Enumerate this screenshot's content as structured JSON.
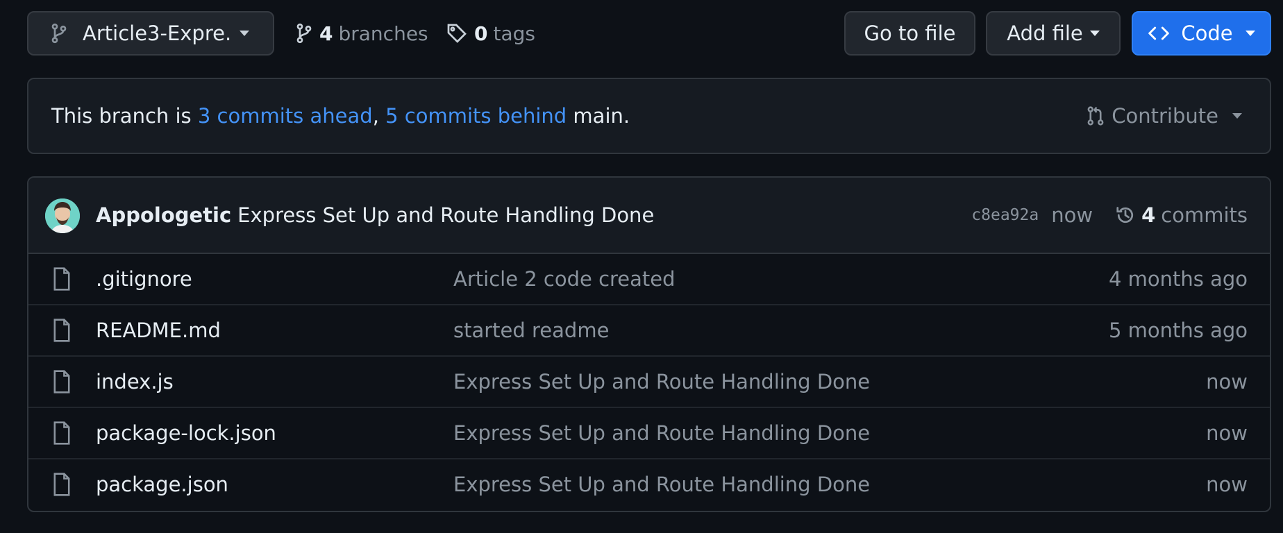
{
  "toolbar": {
    "branch_label": "Article3-Expre...",
    "branches_count": "4",
    "branches_label": "branches",
    "tags_count": "0",
    "tags_label": "tags",
    "go_to_file": "Go to file",
    "add_file": "Add file",
    "code": "Code"
  },
  "status": {
    "prefix": "This branch is ",
    "ahead": "3 commits ahead",
    "sep": ", ",
    "behind": "5 commits behind",
    "suffix": " main.",
    "contribute": "Contribute"
  },
  "latest_commit": {
    "author": "Appologetic",
    "message": "Express Set Up and Route Handling Done",
    "sha": "c8ea92a",
    "time": "now",
    "commits_count": "4",
    "commits_label": "commits"
  },
  "files": [
    {
      "name": ".gitignore",
      "message": "Article 2 code created",
      "time": "4 months ago"
    },
    {
      "name": "README.md",
      "message": "started readme",
      "time": "5 months ago"
    },
    {
      "name": "index.js",
      "message": "Express Set Up and Route Handling Done",
      "time": "now"
    },
    {
      "name": "package-lock.json",
      "message": "Express Set Up and Route Handling Done",
      "time": "now"
    },
    {
      "name": "package.json",
      "message": "Express Set Up and Route Handling Done",
      "time": "now"
    }
  ],
  "colors": {
    "background": "#0d1117",
    "link": "#4493f8",
    "primary_button": "#1f6feb",
    "muted_text": "#8b949e"
  }
}
